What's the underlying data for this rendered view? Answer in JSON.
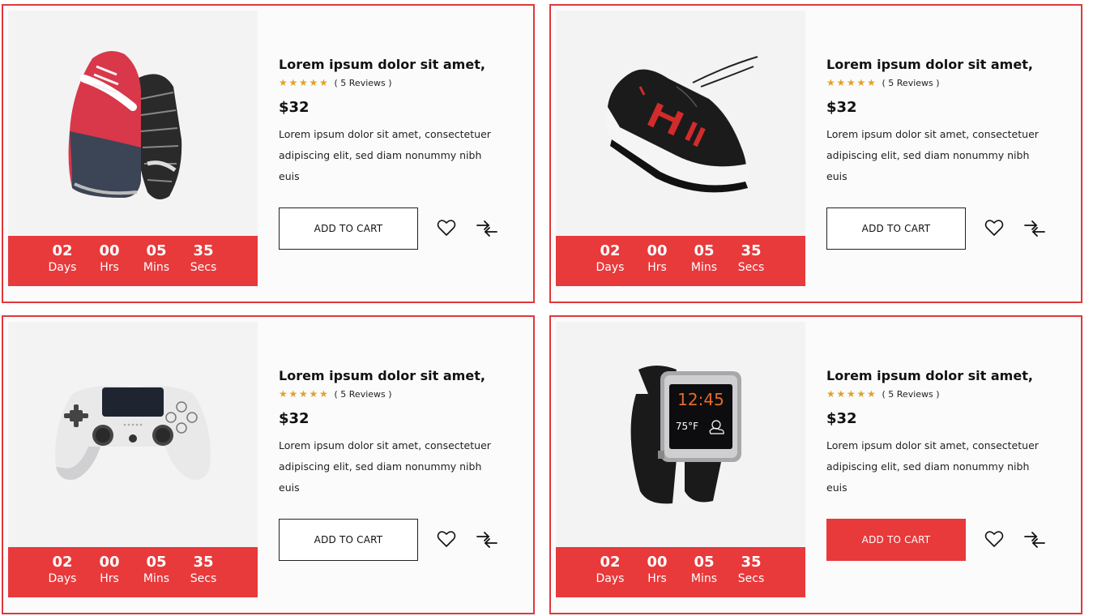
{
  "products": [
    {
      "image_icon": "running-shoe-red-image",
      "title": "Lorem ipsum dolor sit amet,",
      "stars": 5,
      "reviews": "( 5 Reviews )",
      "price": "$32",
      "description": "Lorem ipsum dolor sit amet, consectetuer adipiscing elit, sed diam nonummy nibh euis",
      "timer": {
        "days": "02",
        "days_label": "Days",
        "hrs": "00",
        "hrs_label": "Hrs",
        "mins": "05",
        "mins_label": "Mins",
        "secs": "35",
        "secs_label": "Secs"
      },
      "cart_label": "ADD TO CART",
      "cart_active": false
    },
    {
      "image_icon": "sneaker-black-image",
      "title": "Lorem ipsum dolor sit amet,",
      "stars": 5,
      "reviews": "( 5 Reviews )",
      "price": "$32",
      "description": "Lorem ipsum dolor sit amet, consectetuer adipiscing elit, sed diam nonummy nibh euis",
      "timer": {
        "days": "02",
        "days_label": "Days",
        "hrs": "00",
        "hrs_label": "Hrs",
        "mins": "05",
        "mins_label": "Mins",
        "secs": "35",
        "secs_label": "Secs"
      },
      "cart_label": "ADD TO CART",
      "cart_active": false
    },
    {
      "image_icon": "game-controller-image",
      "title": "Lorem ipsum dolor sit amet,",
      "stars": 5,
      "reviews": "( 5 Reviews )",
      "price": "$32",
      "description": "Lorem ipsum dolor sit amet, consectetuer adipiscing elit, sed diam nonummy nibh euis",
      "timer": {
        "days": "02",
        "days_label": "Days",
        "hrs": "00",
        "hrs_label": "Hrs",
        "mins": "05",
        "mins_label": "Mins",
        "secs": "35",
        "secs_label": "Secs"
      },
      "cart_label": "ADD TO CART",
      "cart_active": false
    },
    {
      "image_icon": "smartwatch-image",
      "title": "Lorem ipsum dolor sit amet,",
      "stars": 5,
      "reviews": "( 5 Reviews )",
      "price": "$32",
      "description": "Lorem ipsum dolor sit amet, consectetuer adipiscing elit, sed diam nonummy nibh euis",
      "watch_time": "12:45",
      "watch_temp": "75°F",
      "timer": {
        "days": "02",
        "days_label": "Days",
        "hrs": "00",
        "hrs_label": "Hrs",
        "mins": "05",
        "mins_label": "Mins",
        "secs": "35",
        "secs_label": "Secs"
      },
      "cart_label": "ADD TO CART",
      "cart_active": true
    }
  ],
  "colors": {
    "accent": "#e8393b",
    "border": "#e0393c",
    "star": "#e2a126"
  },
  "icons": {
    "wishlist": "heart-icon",
    "compare": "compare-arrows-icon",
    "rating": "star-icon"
  }
}
